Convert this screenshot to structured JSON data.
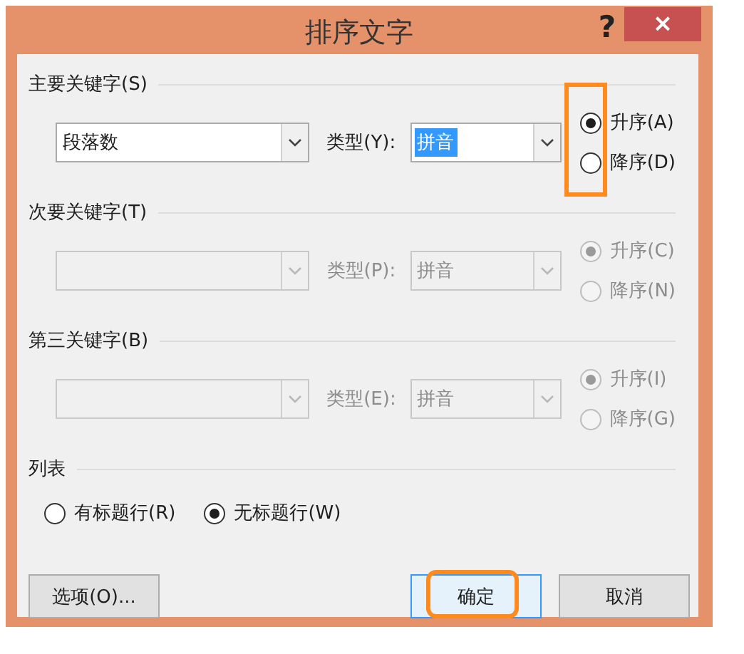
{
  "window": {
    "title": "排序文字",
    "help": "?",
    "close": "×"
  },
  "sort_keys": [
    {
      "heading": "主要关键字(S)",
      "disabled": false,
      "field": "段落数",
      "type_label": "类型(Y):",
      "type_value": "拼音",
      "type_value_selected": true,
      "highlighted": true,
      "order": [
        {
          "label": "升序(A)",
          "selected": true
        },
        {
          "label": "降序(D)",
          "selected": false
        }
      ]
    },
    {
      "heading": "次要关键字(T)",
      "disabled": true,
      "type_label": "类型(P):",
      "type_value": "拼音",
      "type_value_selected": false,
      "highlighted": false,
      "order": [
        {
          "label": "升序(C)",
          "selected": true
        },
        {
          "label": "降序(N)",
          "selected": false
        }
      ]
    },
    {
      "heading": "第三关键字(B)",
      "disabled": true,
      "type_label": "类型(E):",
      "type_value": "拼音",
      "type_value_selected": false,
      "highlighted": false,
      "order": [
        {
          "label": "升序(I)",
          "selected": true
        },
        {
          "label": "降序(G)",
          "selected": false
        }
      ]
    }
  ],
  "list": {
    "heading": "列表",
    "options": [
      {
        "label": "有标题行(R)",
        "selected": false
      },
      {
        "label": "无标题行(W)",
        "selected": true
      }
    ]
  },
  "buttons": [
    {
      "label": "选项(O)...",
      "default": false,
      "highlighted": false
    },
    {
      "label": "确定",
      "default": true,
      "highlighted": true
    },
    {
      "label": "取消",
      "default": false,
      "highlighted": false
    }
  ]
}
